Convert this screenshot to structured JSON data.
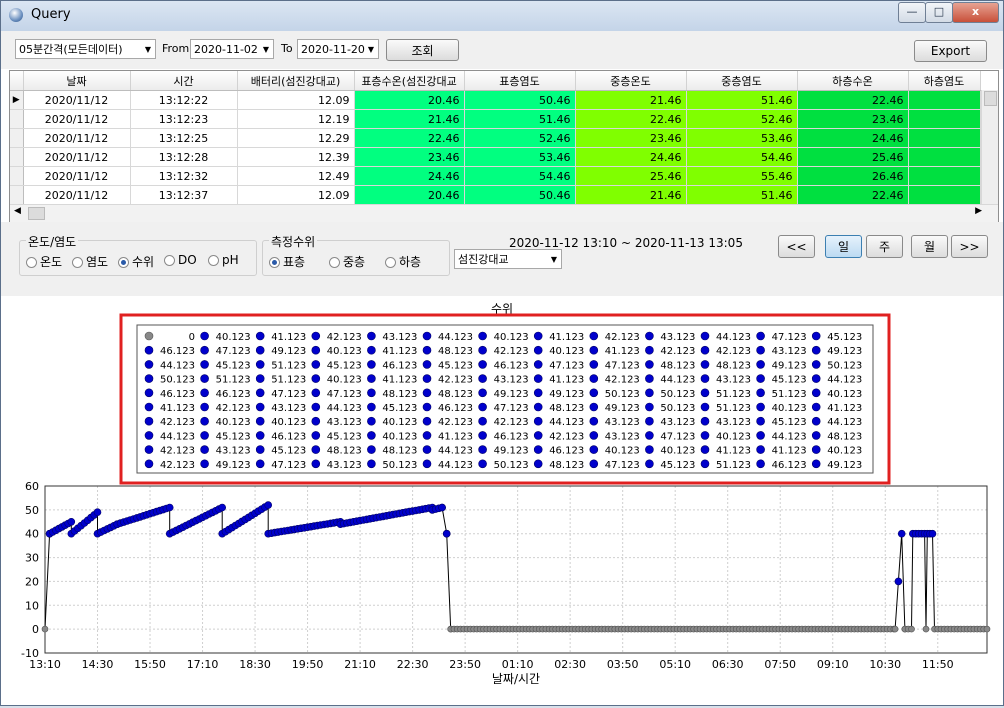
{
  "window": {
    "title": "Query",
    "min_label": "—",
    "max_label": "□",
    "close_label": "x"
  },
  "toolbar": {
    "interval": "05분간격(모든데이터)",
    "from_label": "From",
    "from_date": "2020-11-02",
    "to_label": "To",
    "to_date": "2020-11-20",
    "search_label": "조회",
    "export_label": "Export"
  },
  "grid": {
    "columns": [
      "날짜",
      "시간",
      "배터리(섬진강대교)",
      "표층수온(섬진강대교",
      "표층염도",
      "중층온도",
      "중층염도",
      "하층수온",
      "하층염도"
    ],
    "rows": [
      [
        "2020/11/12",
        "13:12:22",
        "12.09",
        "20.46",
        "50.46",
        "21.46",
        "51.46",
        "22.46",
        ""
      ],
      [
        "2020/11/12",
        "13:12:23",
        "12.19",
        "21.46",
        "51.46",
        "22.46",
        "52.46",
        "23.46",
        ""
      ],
      [
        "2020/11/12",
        "13:12:25",
        "12.29",
        "22.46",
        "52.46",
        "23.46",
        "53.46",
        "24.46",
        ""
      ],
      [
        "2020/11/12",
        "13:12:28",
        "12.39",
        "23.46",
        "53.46",
        "24.46",
        "54.46",
        "25.46",
        ""
      ],
      [
        "2020/11/12",
        "13:12:32",
        "12.49",
        "24.46",
        "54.46",
        "25.46",
        "55.46",
        "26.46",
        ""
      ],
      [
        "2020/11/12",
        "13:12:37",
        "12.09",
        "20.46",
        "50.46",
        "21.46",
        "51.46",
        "22.46",
        ""
      ]
    ]
  },
  "options": {
    "measure_group_label": "온도/염도",
    "measure_options": [
      "온도",
      "염도",
      "수위",
      "DO",
      "pH"
    ],
    "measure_selected": "수위",
    "depth_group_label": "측정수위",
    "depth_options": [
      "표층",
      "중층",
      "하층"
    ],
    "depth_selected": "표층",
    "station": "섬진강대교",
    "range_text": "2020-11-12 13:10 ~ 2020-11-13 13:05",
    "nav_prev": "<<",
    "nav_day": "일",
    "nav_week": "주",
    "nav_month": "월",
    "nav_next": ">>"
  },
  "chart_data": {
    "type": "line",
    "title": "수위",
    "xlabel": "날짜/시간",
    "ylabel": "",
    "ylim": [
      -10,
      60
    ],
    "yticks": [
      -10,
      0,
      10,
      20,
      30,
      40,
      50,
      60
    ],
    "xticks": [
      "13:10",
      "14:30",
      "15:50",
      "17:10",
      "18:30",
      "19:50",
      "21:10",
      "22:30",
      "23:50",
      "01:10",
      "02:30",
      "03:50",
      "05:10",
      "06:30",
      "07:50",
      "09:10",
      "10:30",
      "11:50"
    ],
    "x_start_minutes": 790,
    "x_tick_interval_minutes": 80,
    "x_end_minutes": 2225,
    "grid": true,
    "legend_placement": "top-center",
    "legend_values": [
      "0",
      "40.123",
      "41.123",
      "42.123",
      "43.123",
      "44.123",
      "40.123",
      "41.123",
      "42.123",
      "43.123",
      "44.123",
      "47.123",
      "45.123",
      "46.123",
      "47.123",
      "49.123",
      "40.123",
      "41.123",
      "48.123",
      "42.123",
      "40.123",
      "41.123",
      "42.123",
      "42.123",
      "43.123",
      "49.123",
      "44.123",
      "45.123",
      "51.123",
      "45.123",
      "46.123",
      "45.123",
      "46.123",
      "47.123",
      "47.123",
      "48.123",
      "48.123",
      "49.123",
      "50.123",
      "50.123",
      "51.123",
      "51.123",
      "40.123",
      "41.123",
      "42.123",
      "43.123",
      "41.123",
      "42.123",
      "44.123",
      "43.123",
      "45.123",
      "44.123",
      "46.123",
      "46.123",
      "47.123",
      "47.123",
      "48.123",
      "48.123",
      "49.123",
      "49.123",
      "50.123",
      "50.123",
      "51.123",
      "51.123",
      "40.123",
      "41.123",
      "42.123",
      "43.123",
      "44.123",
      "45.123",
      "46.123",
      "47.123",
      "48.123",
      "49.123",
      "50.123",
      "51.123",
      "40.123",
      "41.123",
      "42.123",
      "40.123",
      "40.123",
      "43.123",
      "40.123",
      "42.123",
      "42.123",
      "44.123",
      "43.123",
      "43.123",
      "43.123",
      "45.123",
      "44.123",
      "44.123",
      "45.123",
      "46.123",
      "45.123",
      "40.123",
      "41.123",
      "46.123",
      "42.123",
      "43.123",
      "47.123",
      "40.123",
      "44.123",
      "48.123",
      "42.123",
      "43.123",
      "45.123",
      "48.123",
      "48.123",
      "44.123",
      "49.123",
      "46.123",
      "40.123",
      "40.123",
      "41.123",
      "41.123",
      "40.123",
      "42.123",
      "49.123",
      "47.123",
      "43.123",
      "50.123",
      "44.123",
      "50.123",
      "48.123",
      "47.123",
      "45.123",
      "51.123",
      "46.123",
      "49.123"
    ],
    "series": [
      {
        "color": "#0000cc",
        "segments": [
          {
            "from": 790,
            "to": 797,
            "y0": 0,
            "y1": 40
          },
          {
            "from": 797,
            "to": 830,
            "y0": 40,
            "y1": 45
          },
          {
            "from": 830,
            "to": 870,
            "y0": 40,
            "y1": 49
          },
          {
            "from": 870,
            "to": 900,
            "y0": 40,
            "y1": 44
          },
          {
            "from": 900,
            "to": 980,
            "y0": 44,
            "y1": 51
          },
          {
            "from": 980,
            "to": 1060,
            "y0": 40,
            "y1": 51
          },
          {
            "from": 1060,
            "to": 1130,
            "y0": 40,
            "y1": 52
          },
          {
            "from": 1130,
            "to": 1240,
            "y0": 40,
            "y1": 45
          },
          {
            "from": 1240,
            "to": 1380,
            "y0": 44,
            "y1": 51
          },
          {
            "from": 1380,
            "to": 1395,
            "y0": 50,
            "y1": 51
          },
          {
            "from": 1395,
            "to": 1402,
            "y0": 51,
            "y1": 40
          },
          {
            "from": 1402,
            "to": 1408,
            "y0": 40,
            "y1": 0
          },
          {
            "from": 2085,
            "to": 2095,
            "y0": 0,
            "y1": 40
          },
          {
            "from": 2112,
            "to": 2130,
            "y0": 40,
            "y1": 40
          },
          {
            "from": 2134,
            "to": 2142,
            "y0": 40,
            "y1": 40
          }
        ]
      }
    ]
  }
}
